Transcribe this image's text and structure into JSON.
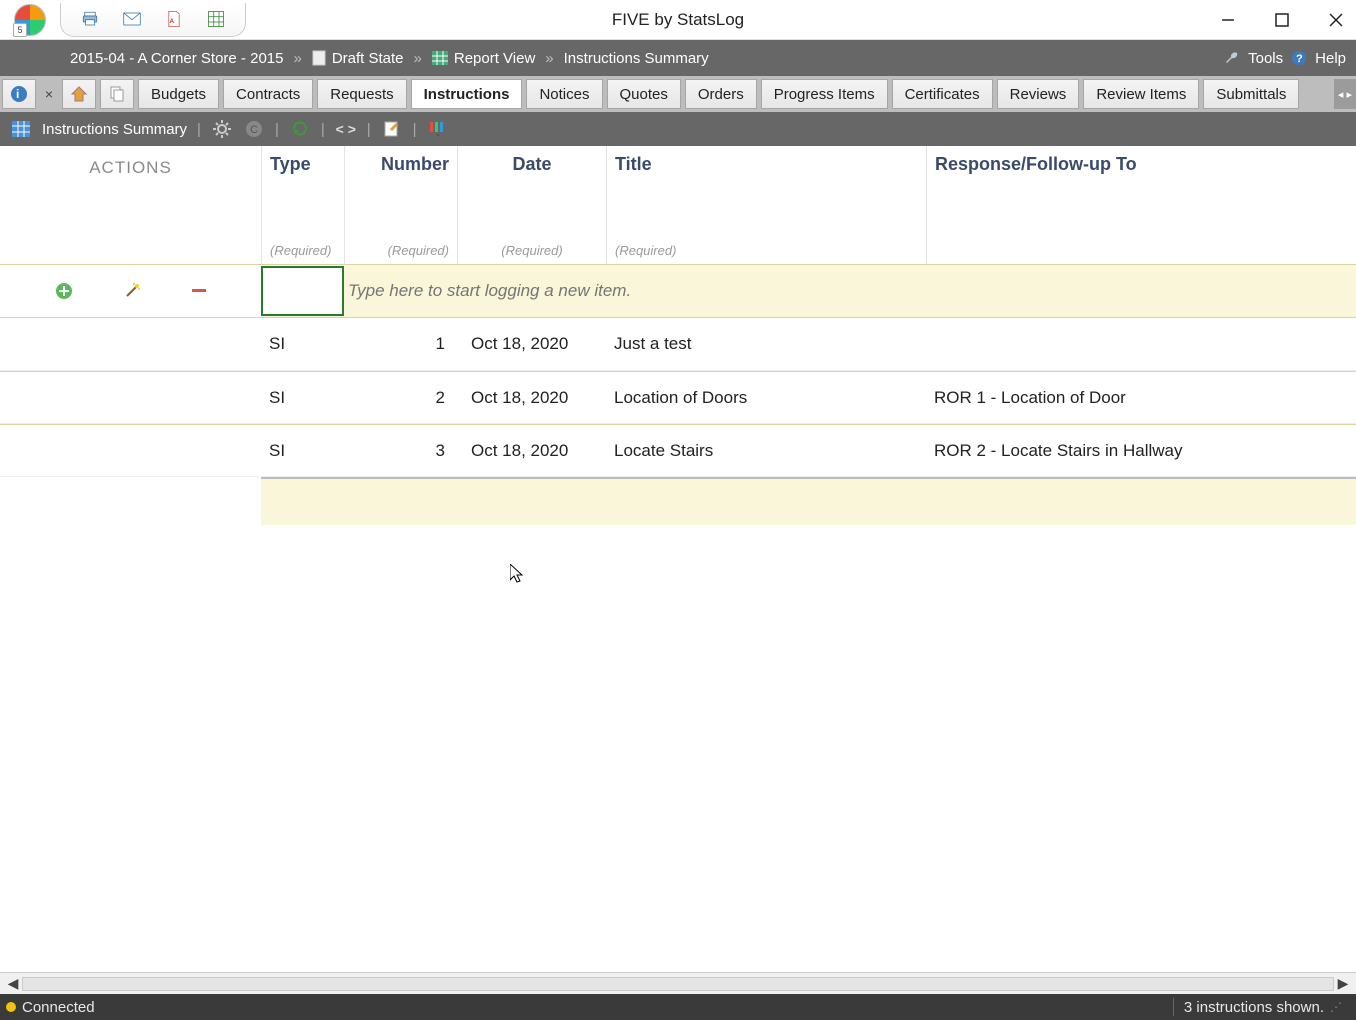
{
  "window": {
    "title": "FIVE by StatsLog"
  },
  "breadcrumb": {
    "project": "2015-04 - A Corner Store - 2015",
    "state": "Draft State",
    "view": "Report View",
    "page": "Instructions Summary"
  },
  "toolbar_right": {
    "tools": "Tools",
    "help": "Help"
  },
  "tabs": [
    {
      "label": "Budgets",
      "active": false
    },
    {
      "label": "Contracts",
      "active": false
    },
    {
      "label": "Requests",
      "active": false
    },
    {
      "label": "Instructions",
      "active": true
    },
    {
      "label": "Notices",
      "active": false
    },
    {
      "label": "Quotes",
      "active": false
    },
    {
      "label": "Orders",
      "active": false
    },
    {
      "label": "Progress Items",
      "active": false
    },
    {
      "label": "Certificates",
      "active": false
    },
    {
      "label": "Reviews",
      "active": false
    },
    {
      "label": "Review Items",
      "active": false
    },
    {
      "label": "Submittals",
      "active": false
    }
  ],
  "view_toolbar": {
    "title": "Instructions Summary"
  },
  "grid": {
    "actions_header": "ACTIONS",
    "columns": {
      "type": {
        "label": "Type",
        "hint": "(Required)"
      },
      "number": {
        "label": "Number",
        "hint": "(Required)"
      },
      "date": {
        "label": "Date",
        "hint": "(Required)"
      },
      "title": {
        "label": "Title",
        "hint": "(Required)"
      },
      "response": {
        "label": "Response/Follow-up To",
        "hint": ""
      }
    },
    "new_row_placeholder": "Type here to start logging a new item.",
    "rows": [
      {
        "type": "SI",
        "number": "1",
        "date": "Oct 18, 2020",
        "title": "Just a test",
        "response": ""
      },
      {
        "type": "SI",
        "number": "2",
        "date": "Oct 18, 2020",
        "title": "Location of Doors",
        "response": "ROR 1 - Location of Door"
      },
      {
        "type": "SI",
        "number": "3",
        "date": "Oct 18, 2020",
        "title": "Locate Stairs",
        "response": "ROR 2 - Locate Stairs in Hallway"
      }
    ]
  },
  "status": {
    "connection": "Connected",
    "count": "3 instructions shown."
  }
}
